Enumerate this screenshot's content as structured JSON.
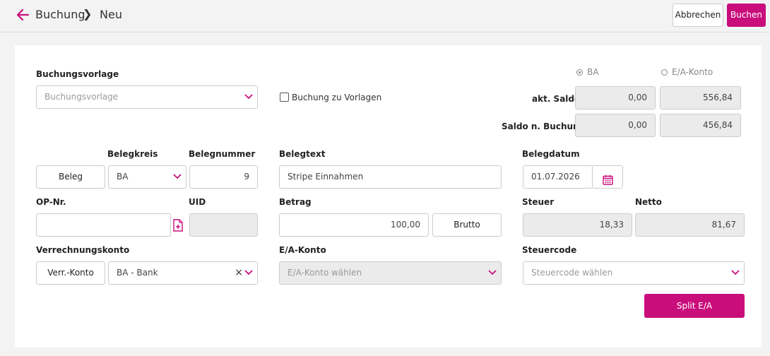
{
  "header": {
    "breadcrumb_1": "Buchung",
    "breadcrumb_sep": "❯",
    "breadcrumb_2": "Neu",
    "cancel_label": "Abbrechen",
    "book_label": "Buchen",
    "back_icon": "arrow-left-icon"
  },
  "colors": {
    "accent": "#c90e7c",
    "readonly_bg": "#ebebeb"
  },
  "form": {
    "buchungsvorlage": {
      "label": "Buchungsvorlage",
      "placeholder": "Buchungsvorlage"
    },
    "zu_vorlagen": {
      "label": "Buchung zu Vorlagen",
      "checked": false
    },
    "konto_radio": {
      "option_ba": "BA",
      "option_ea": "E/A-Konto",
      "selected": "BA"
    },
    "akt_saldo": {
      "label": "akt. Saldo",
      "ba": "0,00",
      "ea": "556,84"
    },
    "saldo_n_buchung": {
      "label": "Saldo n. Buchung",
      "ba": "0,00",
      "ea": "456,84"
    },
    "beleg_button": "Beleg",
    "belegkreis": {
      "label": "Belegkreis",
      "value": "BA"
    },
    "belegnummer": {
      "label": "Belegnummer",
      "value": "9"
    },
    "belegtext": {
      "label": "Belegtext",
      "value": "Stripe Einnahmen"
    },
    "belegdatum": {
      "label": "Belegdatum",
      "value": "01.07.2026"
    },
    "op_nr": {
      "label": "OP-Nr.",
      "value": ""
    },
    "uid": {
      "label": "UID",
      "value": ""
    },
    "betrag": {
      "label": "Betrag",
      "value": "100,00",
      "mode_button": "Brutto"
    },
    "steuer": {
      "label": "Steuer",
      "value": "18,33"
    },
    "netto": {
      "label": "Netto",
      "value": "81,67"
    },
    "verrechnungskonto": {
      "label": "Verrechnungskonto",
      "button": "Verr.-Konto",
      "value": "BA - Bank",
      "clear": "×"
    },
    "ea_konto": {
      "label": "E/A-Konto",
      "placeholder": "E/A-Konto wählen"
    },
    "steuercode": {
      "label": "Steuercode",
      "placeholder": "Steuercode wählen"
    },
    "split_button": "Split E/A"
  }
}
